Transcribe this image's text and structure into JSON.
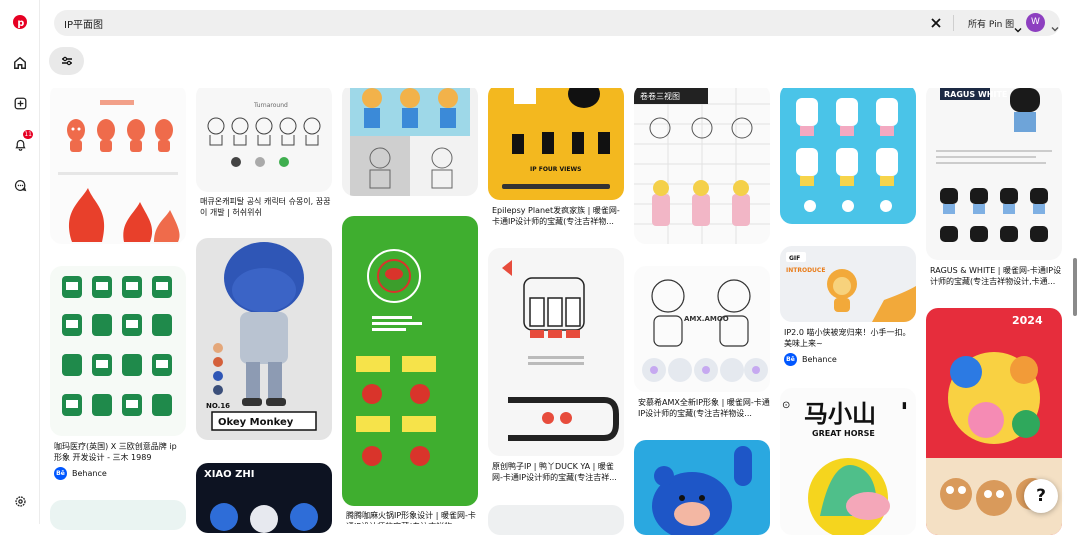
{
  "search": {
    "query": "IP平面图",
    "scope": "所有 Pin 图"
  },
  "user": {
    "avatar_initial": "W"
  },
  "nav": {
    "notifications_badge": "11"
  },
  "pins": {
    "monkey_title": "Okey Monkey",
    "monkey_number": "NO.16",
    "mahorse_title": "马小山",
    "mahorse_sub": "GREAT HORSE",
    "xiaozhi": "XIAO ZHI",
    "ragus": "RAGUS WHITE",
    "three_views": "卷卷三视图",
    "four_views": "IP FOUR VIEWS",
    "amx_label": "AMX.AMOO",
    "gif_tag": "GIF",
    "introduce": "INTRODUCE",
    "year_2024": "2024",
    "turnaround": "Turnaround"
  },
  "captions": {
    "c2": "매큐온캐피탈 공식 캐릭터 슈몽이, 꿈꿈이 개발 | 허쉬위쉬",
    "c1": "咖玛医疗(英国) X 三欧创意品牌 ip形象 开发设计 - 三木 1989",
    "c3": "腾腾咖麻火锅IP形象设计 | 暖雀网-卡通IP设计师的宝藏(专注吉祥物...",
    "c4a": "Epilepsy Planet发疯家族 | 暖雀网-卡通IP设计师的宝藏(专注吉祥物...",
    "c4b": "原创鸭子IP | 鸭丫DUCK YA | 暖雀网-卡通IP设计师的宝藏(专注吉祥...",
    "c5": "安慕希AMX全新IP形象 | 暖雀网-卡通IP设计师的宝藏(专注吉祥物设...",
    "c6": "IP2.0 喵小侠被宠归来！小手一扣。美味上来~",
    "c7": "RAGUS & WHITE | 暖雀网-卡通IP设计师的宝藏(专注吉祥物设计,卡通..."
  },
  "sources": {
    "behance": "Behance",
    "behance_icon": "Bē"
  },
  "colors": {
    "brand": "#e60023",
    "avatar": "#8d3fc0"
  }
}
